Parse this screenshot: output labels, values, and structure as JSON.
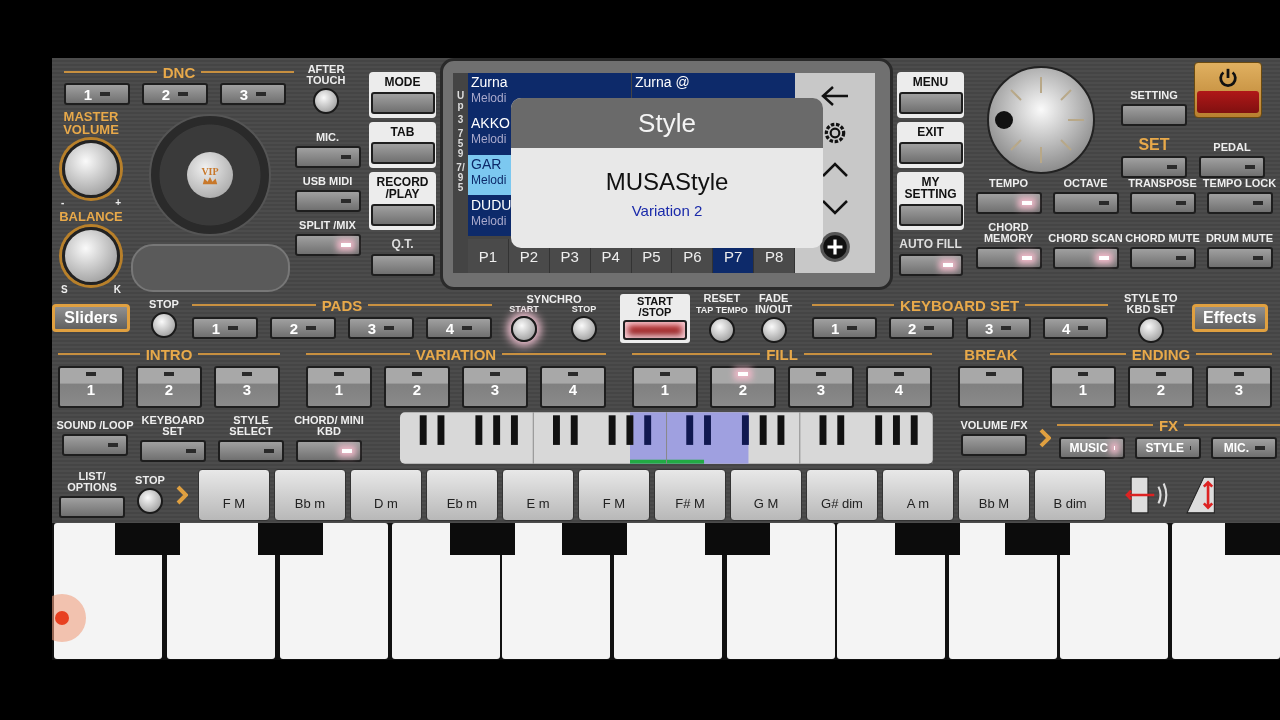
{
  "dnc": {
    "title": "DNC",
    "buttons": [
      {
        "label": "1",
        "lit": false
      },
      {
        "label": "2",
        "lit": false
      },
      {
        "label": "3",
        "lit": false
      }
    ],
    "after_touch": "AFTER TOUCH"
  },
  "knobs": [
    {
      "title": "MASTER VOLUME",
      "marks": [
        "-",
        "+"
      ]
    },
    {
      "title": "BALANCE",
      "marks": [
        "S",
        "K"
      ]
    }
  ],
  "vip": "VIP",
  "side_buttons": [
    {
      "label": "MIC.",
      "lit": false
    },
    {
      "label": "USB MIDI",
      "lit": false
    },
    {
      "label": "SPLIT /MIX",
      "lit": true
    }
  ],
  "mode_buttons": [
    {
      "label": "MODE",
      "kind": "light"
    },
    {
      "label": "TAB",
      "kind": "light"
    },
    {
      "label": "RECORD /PLAY",
      "kind": "light"
    },
    {
      "label": "Q.T.",
      "kind": "dark"
    }
  ],
  "display": {
    "side_text": [
      "Up",
      "3",
      "759",
      "7/95"
    ],
    "left_column": [
      {
        "name": "Zurna",
        "category": "Melodi",
        "selected": false
      },
      {
        "name": "AKKO",
        "category": "Melodi",
        "selected": false
      },
      {
        "name": "GAR",
        "category": "Melodi",
        "selected": true
      },
      {
        "name": "DUDU",
        "category": "Melodi",
        "selected": false
      }
    ],
    "right_column": [
      {
        "name": "Zurna @",
        "selected": false
      }
    ],
    "pages": [
      {
        "label": "P1",
        "selected": false
      },
      {
        "label": "P2",
        "selected": false
      },
      {
        "label": "P3",
        "selected": false
      },
      {
        "label": "P4",
        "selected": false
      },
      {
        "label": "P5",
        "selected": false
      },
      {
        "label": "P6",
        "selected": false
      },
      {
        "label": "P7",
        "selected": true
      },
      {
        "label": "P8",
        "selected": false
      }
    ],
    "popup": {
      "title": "Style",
      "name": "MUSAStyle",
      "variation": "Variation 2"
    }
  },
  "menu_buttons": [
    {
      "label": "MENU",
      "kind": "light",
      "lit": false
    },
    {
      "label": "EXIT",
      "kind": "light",
      "lit": false
    },
    {
      "label": "MY SETTING",
      "kind": "light",
      "lit": false
    },
    {
      "label": "AUTO FILL",
      "kind": "dark",
      "lit": true
    }
  ],
  "setting": "SETTING",
  "set": {
    "title": "SET",
    "lit": false
  },
  "pedal": {
    "label": "PEDAL",
    "lit": false
  },
  "function_grid": [
    {
      "label": "TEMPO",
      "lit": true
    },
    {
      "label": "OCTAVE",
      "lit": false
    },
    {
      "label": "TRANSPOSE",
      "lit": false
    },
    {
      "label": "TEMPO LOCK",
      "lit": false
    },
    {
      "label": "CHORD MEMORY",
      "lit": true
    },
    {
      "label": "CHORD SCAN",
      "lit": true
    },
    {
      "label": "CHORD MUTE",
      "lit": false
    },
    {
      "label": "DRUM MUTE",
      "lit": false
    }
  ],
  "sliders": "Sliders",
  "pads_stop": "STOP",
  "pads": {
    "title": "PADS",
    "buttons": [
      {
        "label": "1",
        "lit": false
      },
      {
        "label": "2",
        "lit": false
      },
      {
        "label": "3",
        "lit": false
      },
      {
        "label": "4",
        "lit": false
      }
    ]
  },
  "synchro": {
    "title": "SYNCHRO",
    "knobs": [
      {
        "label": "START",
        "lit": true
      },
      {
        "label": "STOP",
        "lit": false
      }
    ]
  },
  "start_stop": {
    "label": "START /STOP",
    "lit": true
  },
  "reset": {
    "title": "RESET",
    "subtitle": "TAP TEMPO"
  },
  "fade": "FADE IN/OUT",
  "keyboard_set": {
    "title": "KEYBOARD SET",
    "buttons": [
      {
        "label": "1",
        "lit": false
      },
      {
        "label": "2",
        "lit": false
      },
      {
        "label": "3",
        "lit": false
      },
      {
        "label": "4",
        "lit": false
      }
    ]
  },
  "style_to_kbd": "STYLE TO KBD SET",
  "effects": "Effects",
  "sections": [
    {
      "title": "INTRO",
      "buttons": [
        {
          "label": "1",
          "lit": false
        },
        {
          "label": "2",
          "lit": false
        },
        {
          "label": "3",
          "lit": false
        }
      ]
    },
    {
      "title": "VARIATION",
      "buttons": [
        {
          "label": "1",
          "lit": false
        },
        {
          "label": "2",
          "lit": false
        },
        {
          "label": "3",
          "lit": false
        },
        {
          "label": "4",
          "lit": false
        }
      ]
    },
    {
      "title": "FILL",
      "buttons": [
        {
          "label": "1",
          "lit": false
        },
        {
          "label": "2",
          "lit": true
        },
        {
          "label": "3",
          "lit": false
        },
        {
          "label": "4",
          "lit": false
        }
      ]
    },
    {
      "title": "BREAK",
      "buttons": [
        {
          "lit": false
        }
      ]
    },
    {
      "title": "ENDING",
      "buttons": [
        {
          "label": "1",
          "lit": false
        },
        {
          "label": "2",
          "lit": false
        },
        {
          "label": "3",
          "lit": false
        }
      ]
    }
  ],
  "lower_buttons": [
    {
      "label": "SOUND /LOOP",
      "lit": false
    },
    {
      "label": "KEYBOARD SET",
      "lit": false
    },
    {
      "label": "STYLE SELECT",
      "lit": false
    },
    {
      "label": "CHORD/ MINI KBD",
      "lit": true
    }
  ],
  "volume_fx": "VOLUME /FX",
  "fx": {
    "title": "FX",
    "buttons": [
      {
        "label": "MUSIC",
        "lit": true
      },
      {
        "label": "STYLE",
        "lit": false
      },
      {
        "label": "MIC.",
        "lit": false
      }
    ]
  },
  "list_options": "LIST/ OPTIONS",
  "chord_stop": "STOP",
  "chords": [
    "F M",
    "Bb m",
    "D m",
    "Eb m",
    "E m",
    "F M",
    "F# M",
    "G M",
    "G# dim",
    "A m",
    "Bb M",
    "B dim"
  ]
}
